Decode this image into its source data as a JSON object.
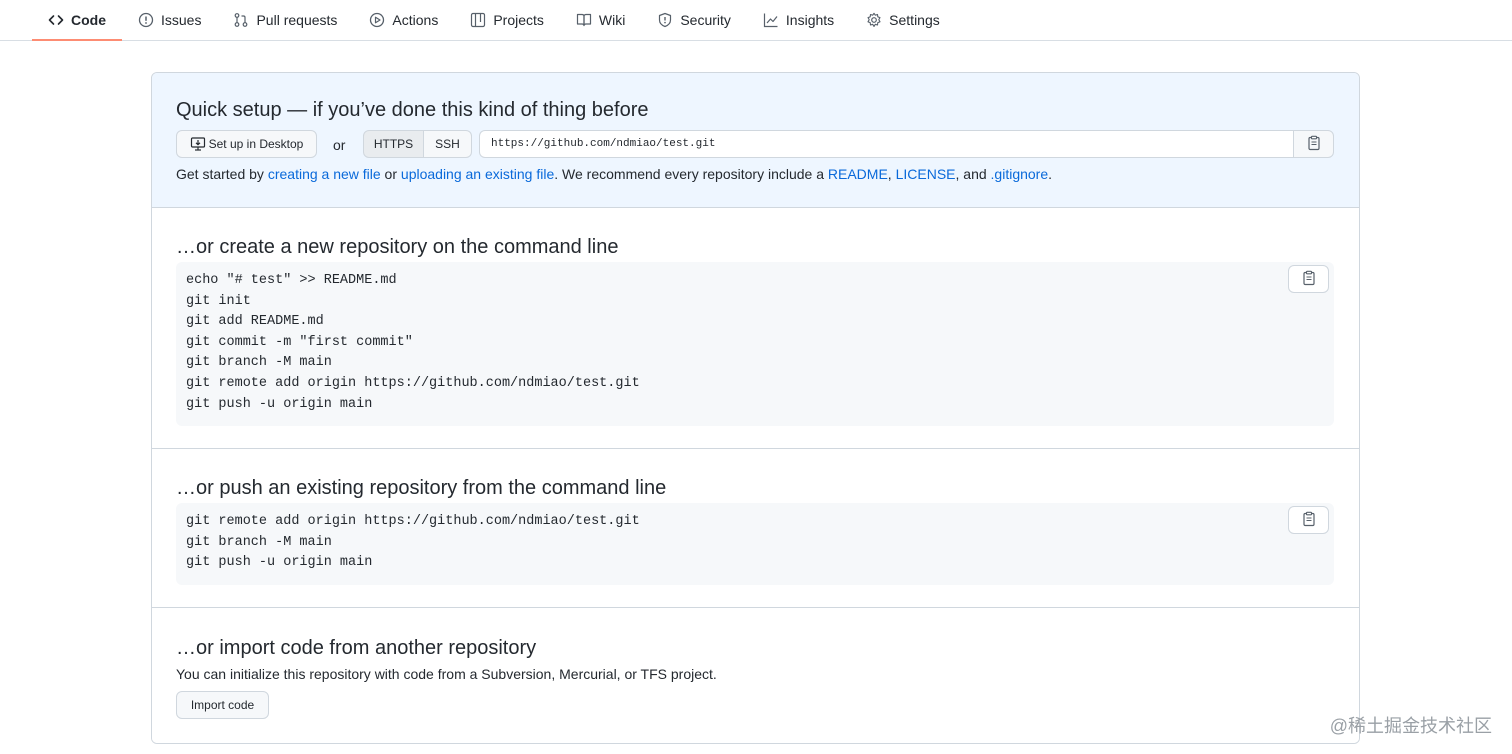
{
  "nav": {
    "items": [
      {
        "label": "Code",
        "icon": "code-icon"
      },
      {
        "label": "Issues",
        "icon": "issue-icon"
      },
      {
        "label": "Pull requests",
        "icon": "pull-request-icon"
      },
      {
        "label": "Actions",
        "icon": "play-icon"
      },
      {
        "label": "Projects",
        "icon": "table-icon"
      },
      {
        "label": "Wiki",
        "icon": "book-icon"
      },
      {
        "label": "Security",
        "icon": "shield-icon"
      },
      {
        "label": "Insights",
        "icon": "graph-icon"
      },
      {
        "label": "Settings",
        "icon": "gear-icon"
      }
    ],
    "selected": "Code",
    "accent_color": "#fd8c73"
  },
  "quick_setup": {
    "title": "Quick setup — if you’ve done this kind of thing before",
    "desktop_button": "Set up in Desktop",
    "or": "or",
    "https_label": "HTTPS",
    "ssh_label": "SSH",
    "clone_url": "https://github.com/ndmiao/test.git",
    "get_started": {
      "prefix": "Get started by ",
      "link1": "creating a new file",
      "mid1": " or ",
      "link2": "uploading an existing file",
      "mid2": ". We recommend every repository include a ",
      "link3": "README",
      "comma1": ", ",
      "link4": "LICENSE",
      "mid3": ", and ",
      "link5": ".gitignore",
      "suffix": "."
    },
    "background_color": "#eef6ff",
    "link_color": "#0969da"
  },
  "new_repo": {
    "title": "…or create a new repository on the command line",
    "lines": [
      "echo \"# test\" >> README.md",
      "git init",
      "git add README.md",
      "git commit -m \"first commit\"",
      "git branch -M main",
      "git remote add origin https://github.com/ndmiao/test.git",
      "git push -u origin main"
    ]
  },
  "push_existing": {
    "title": "…or push an existing repository from the command line",
    "lines": [
      "git remote add origin https://github.com/ndmiao/test.git",
      "git branch -M main",
      "git push -u origin main"
    ]
  },
  "import": {
    "title": "…or import code from another repository",
    "description": "You can initialize this repository with code from a Subversion, Mercurial, or TFS project.",
    "button": "Import code"
  },
  "watermark": "@稀土掘金技术社区"
}
